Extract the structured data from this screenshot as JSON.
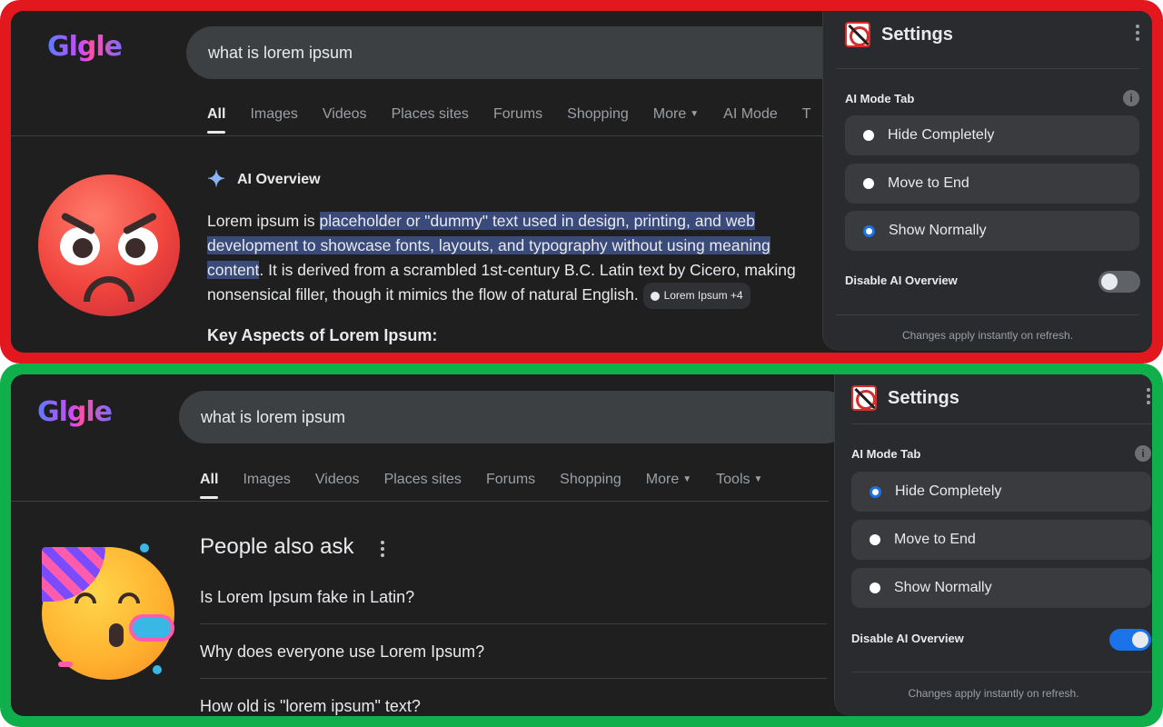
{
  "before": {
    "logo": "Glgle",
    "query": "what is lorem ipsum",
    "tabs": [
      "All",
      "Images",
      "Videos",
      "Places sites",
      "Forums",
      "Shopping",
      "More",
      "AI Mode",
      "T"
    ],
    "ai_overview": {
      "label": "AI Overview",
      "text_prefix": "Lorem ipsum is ",
      "text_highlight": "placeholder or \"dummy\" text used in design, printing, and web development to showcase fonts, layouts, and typography without using meaning content",
      "text_suffix": ". It is derived from a scrambled 1st-century B.C. Latin text by Cicero, making nonsensical filler, though it mimics the flow of natural English.",
      "chip": "Lorem Ipsum +4",
      "key_aspects": "Key Aspects of Lorem Ipsum:"
    },
    "settings": {
      "title": "Settings",
      "section": "AI Mode Tab",
      "options": [
        "Hide Completely",
        "Move to End",
        "Show Normally"
      ],
      "selected": 2,
      "toggle_label": "Disable AI Overview",
      "toggle_on": false,
      "footer": "Changes apply instantly on refresh."
    }
  },
  "after": {
    "logo": "Glgle",
    "query": "what is lorem ipsum",
    "tabs": [
      "All",
      "Images",
      "Videos",
      "Places sites",
      "Forums",
      "Shopping",
      "More",
      "Tools"
    ],
    "people_also_ask": {
      "title": "People also ask",
      "questions": [
        "Is Lorem Ipsum fake in Latin?",
        "Why does everyone use Lorem Ipsum?",
        "How old is \"lorem ipsum\" text?"
      ]
    },
    "settings": {
      "title": "Settings",
      "section": "AI Mode Tab",
      "options": [
        "Hide Completely",
        "Move to End",
        "Show Normally"
      ],
      "selected": 0,
      "toggle_label": "Disable AI Overview",
      "toggle_on": true,
      "footer": "Changes apply instantly on refresh."
    }
  },
  "colors": {
    "before_frame": "#e3181e",
    "after_frame": "#0fb04b",
    "accent": "#1a73e8",
    "highlight": "#3a4a7a"
  },
  "icons": [
    "sparkle-icon",
    "info-icon",
    "kebab-icon",
    "angry-face-emoji",
    "party-face-emoji",
    "extension-logo-icon"
  ]
}
